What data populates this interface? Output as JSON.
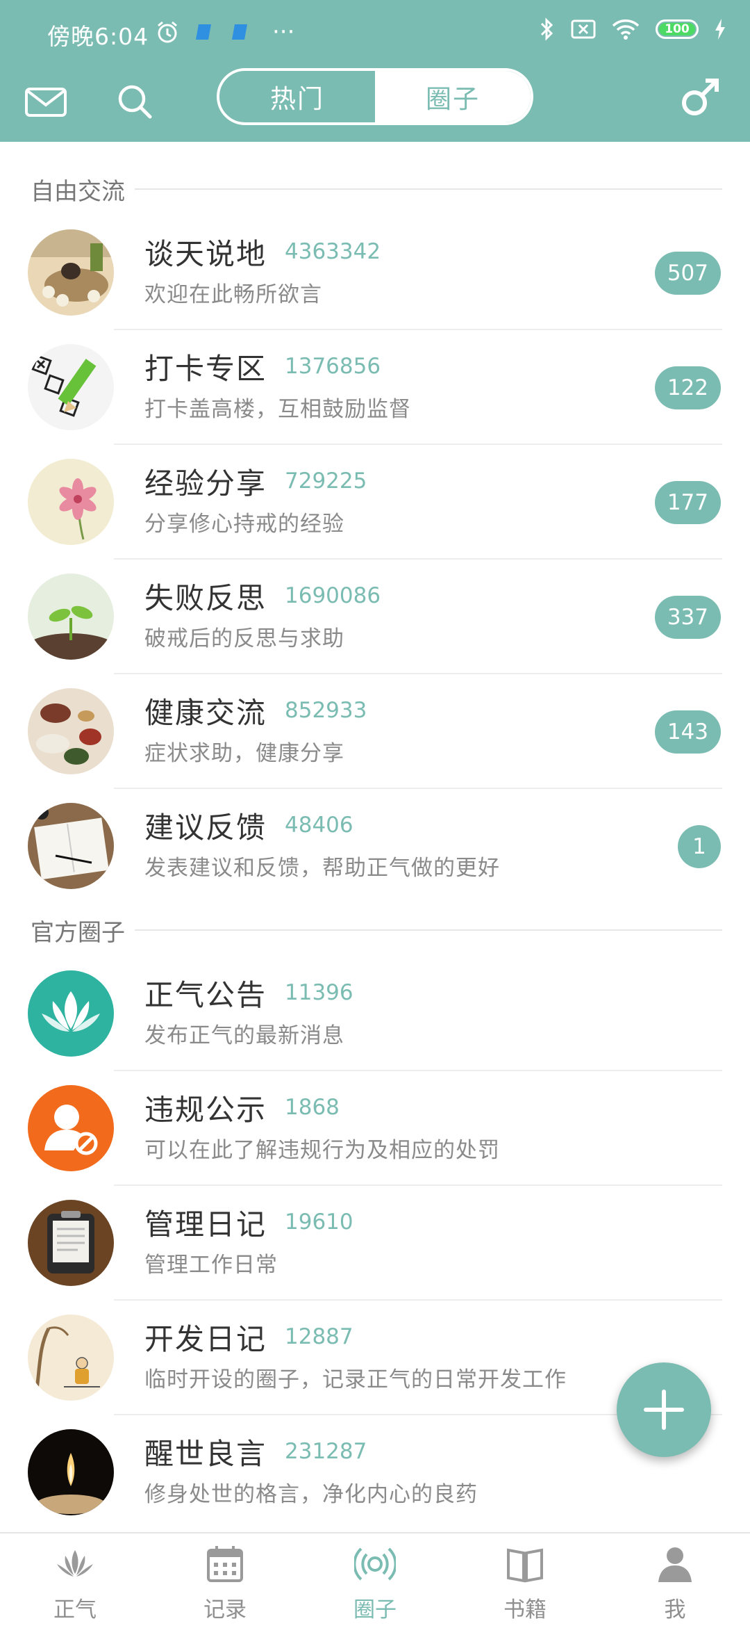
{
  "status_bar": {
    "time": "傍晚6:04",
    "more": "···",
    "battery": "100"
  },
  "header": {
    "tabs": [
      {
        "label": "热门",
        "active": false
      },
      {
        "label": "圈子",
        "active": true
      }
    ]
  },
  "sections": [
    {
      "title": "自由交流",
      "groups": [
        {
          "name": "谈天说地",
          "members": "4363342",
          "desc": "欢迎在此畅所欲言",
          "badge": "507",
          "icon": "tea-set-image"
        },
        {
          "name": "打卡专区",
          "members": "1376856",
          "desc": "打卡盖高楼，互相鼓励监督",
          "badge": "122",
          "icon": "checklist-pencil-image"
        },
        {
          "name": "经验分享",
          "members": "729225",
          "desc": "分享修心持戒的经验",
          "badge": "177",
          "icon": "pink-flower-image"
        },
        {
          "name": "失败反思",
          "members": "1690086",
          "desc": "破戒后的反思与求助",
          "badge": "337",
          "icon": "sprout-image"
        },
        {
          "name": "健康交流",
          "members": "852933",
          "desc": "症状求助，健康分享",
          "badge": "143",
          "icon": "herbs-image"
        },
        {
          "name": "建议反馈",
          "members": "48406",
          "desc": "发表建议和反馈，帮助正气做的更好",
          "badge": "1",
          "icon": "notebook-image"
        }
      ]
    },
    {
      "title": "官方圈子",
      "groups": [
        {
          "name": "正气公告",
          "members": "11396",
          "desc": "发布正气的最新消息",
          "icon": "lotus-image"
        },
        {
          "name": "违规公示",
          "members": "1868",
          "desc": "可以在此了解违规行为及相应的处罚",
          "icon": "banned-user-image"
        },
        {
          "name": "管理日记",
          "members": "19610",
          "desc": "管理工作日常",
          "icon": "clipboard-image"
        },
        {
          "name": "开发日记",
          "members": "12887",
          "desc": "临时开设的圈子，记录正气的日常开发工作",
          "icon": "monk-painting-image"
        },
        {
          "name": "醒世良言",
          "members": "231287",
          "desc": "修身处世的格言，净化内心的良药",
          "icon": "candle-image"
        }
      ]
    }
  ],
  "bottom_nav": [
    {
      "label": "正气",
      "icon": "lotus-icon",
      "active": false
    },
    {
      "label": "记录",
      "icon": "calendar-icon",
      "active": false
    },
    {
      "label": "圈子",
      "icon": "broadcast-icon",
      "active": true
    },
    {
      "label": "书籍",
      "icon": "book-icon",
      "active": false
    },
    {
      "label": "我",
      "icon": "person-icon",
      "active": false
    }
  ],
  "colors": {
    "accent": "#7bbcb2",
    "badge": "#7bbcb2",
    "text": "#333333",
    "secondary_text": "#8a8a8a"
  }
}
